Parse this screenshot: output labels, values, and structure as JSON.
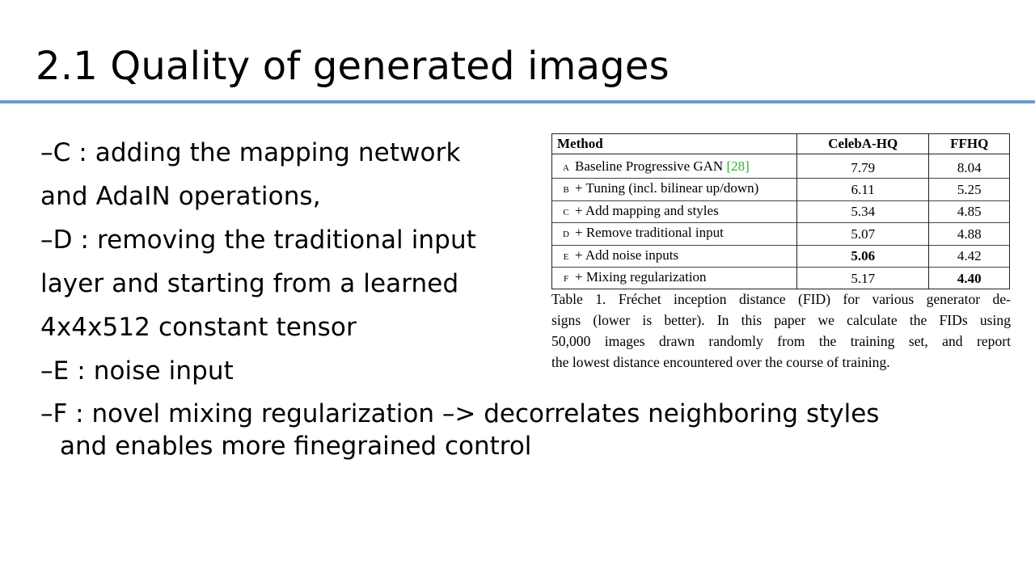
{
  "slide": {
    "title": "2.1 Quality of generated images"
  },
  "bullets": [
    {
      "text_lines": [
        "–C : adding the mapping network",
        "and AdaIN operations,"
      ]
    },
    {
      "text_lines": [
        "–D : removing the traditional input",
        "layer and starting from a learned",
        "4x4x512 constant tensor"
      ]
    },
    {
      "text_lines": [
        "–E : noise input"
      ]
    },
    {
      "text_lines": [
        "–F : novel mixing regularization –> decorrelates neighboring styles",
        "and enables more finegrained control"
      ]
    }
  ],
  "table": {
    "headers": [
      "Method",
      "CelebA-HQ",
      "FFHQ"
    ],
    "rows": [
      {
        "letter": "A",
        "method": "Baseline Progressive GAN",
        "cite": "[28]",
        "celeba": "7.79",
        "ffhq": "8.04"
      },
      {
        "letter": "B",
        "method": "+ Tuning (incl. bilinear up/down)",
        "celeba": "6.11",
        "ffhq": "5.25"
      },
      {
        "letter": "C",
        "method": "+ Add mapping and styles",
        "celeba": "5.34",
        "ffhq": "4.85"
      },
      {
        "letter": "D",
        "method": "+ Remove traditional input",
        "celeba": "5.07",
        "ffhq": "4.88"
      },
      {
        "letter": "E",
        "method": "+ Add noise inputs",
        "celeba": "5.06",
        "ffhq": "4.42"
      },
      {
        "letter": "F",
        "method": "+ Mixing regularization",
        "celeba": "5.17",
        "ffhq": "4.40"
      }
    ],
    "bold_cells": {
      "celeba": "E",
      "ffhq": "F"
    },
    "cite_color": "#27b427"
  },
  "caption_lines": [
    "Table 1. Fréchet inception distance (FID) for various generator de-",
    "signs (lower is better).  In this paper we calculate the FIDs using",
    "50,000 images drawn randomly from the training set, and report",
    "the lowest distance encountered over the course of training."
  ],
  "colors": {
    "title_rule": "#6d9bc9"
  }
}
